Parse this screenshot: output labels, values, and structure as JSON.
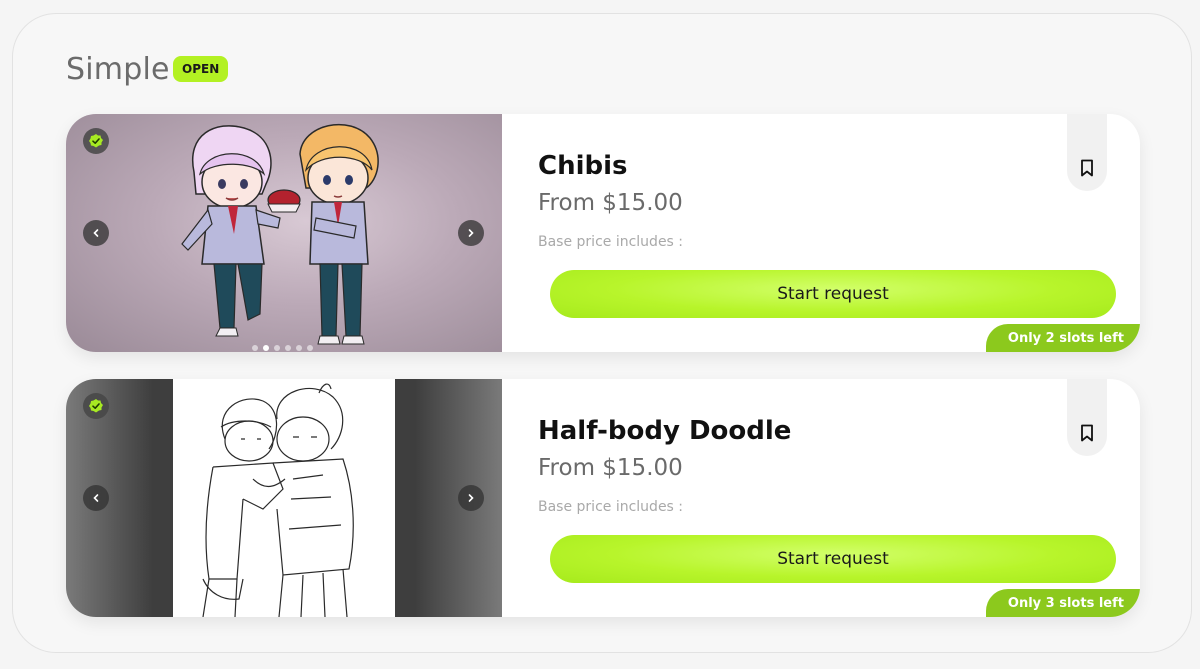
{
  "section": {
    "title": "Simple",
    "badge": "OPEN"
  },
  "colors": {
    "accent": "#b3f123",
    "slots_badge": "#8cc91d",
    "card_bg": "#ffffff",
    "page_bg": "#f5f5f5"
  },
  "cards": [
    {
      "title": "Chibis",
      "price": "From $15.00",
      "note": "Base price includes :",
      "button": "Start request",
      "slots": "Only 2 slots left",
      "carousel": {
        "total": 6,
        "active_index": 1
      },
      "icons": {
        "verified": "verified-check-icon",
        "bookmark": "bookmark-icon",
        "prev": "chevron-left-icon",
        "next": "chevron-right-icon"
      }
    },
    {
      "title": "Half-body Doodle",
      "price": "From $15.00",
      "note": "Base price includes :",
      "button": "Start request",
      "slots": "Only 3 slots left",
      "icons": {
        "verified": "verified-check-icon",
        "bookmark": "bookmark-icon",
        "prev": "chevron-left-icon",
        "next": "chevron-right-icon"
      }
    }
  ]
}
